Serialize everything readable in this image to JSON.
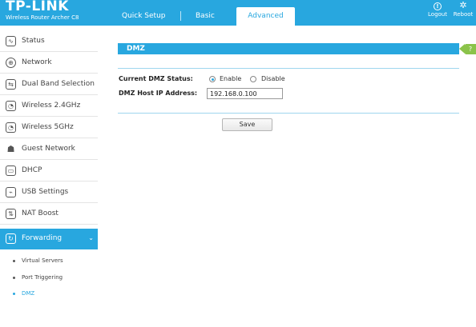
{
  "header": {
    "brand": "TP-LINK",
    "model": "Wireless Router Archer C8",
    "tabs": [
      {
        "label": "Quick Setup"
      },
      {
        "label": "Basic"
      },
      {
        "label": "Advanced"
      }
    ],
    "active_tab": "Advanced",
    "logout_label": "Logout",
    "reboot_label": "Reboot",
    "accent_color": "#28a7df"
  },
  "sidebar": {
    "items": [
      {
        "label": "Status",
        "icon": "status-icon"
      },
      {
        "label": "Network",
        "icon": "globe-icon"
      },
      {
        "label": "Dual Band Selection",
        "icon": "dual-band-icon"
      },
      {
        "label": "Wireless 2.4GHz",
        "icon": "wifi-icon"
      },
      {
        "label": "Wireless 5GHz",
        "icon": "wifi-icon"
      },
      {
        "label": "Guest Network",
        "icon": "guest-users-icon"
      },
      {
        "label": "DHCP",
        "icon": "monitor-icon"
      },
      {
        "label": "USB Settings",
        "icon": "usb-icon"
      },
      {
        "label": "NAT Boost",
        "icon": "nat-icon"
      },
      {
        "label": "Forwarding",
        "icon": "forwarding-icon"
      }
    ],
    "active_item": "Forwarding",
    "sub_items": [
      {
        "label": "Virtual Servers"
      },
      {
        "label": "Port Triggering"
      },
      {
        "label": "DMZ"
      }
    ],
    "active_sub_item": "DMZ"
  },
  "main": {
    "section_title": "DMZ",
    "status_label": "Current DMZ Status:",
    "enable_label": "Enable",
    "disable_label": "Disable",
    "status_value": "Enable",
    "ip_label": "DMZ Host IP Address:",
    "ip_value": "192.168.0.100",
    "save_label": "Save"
  }
}
